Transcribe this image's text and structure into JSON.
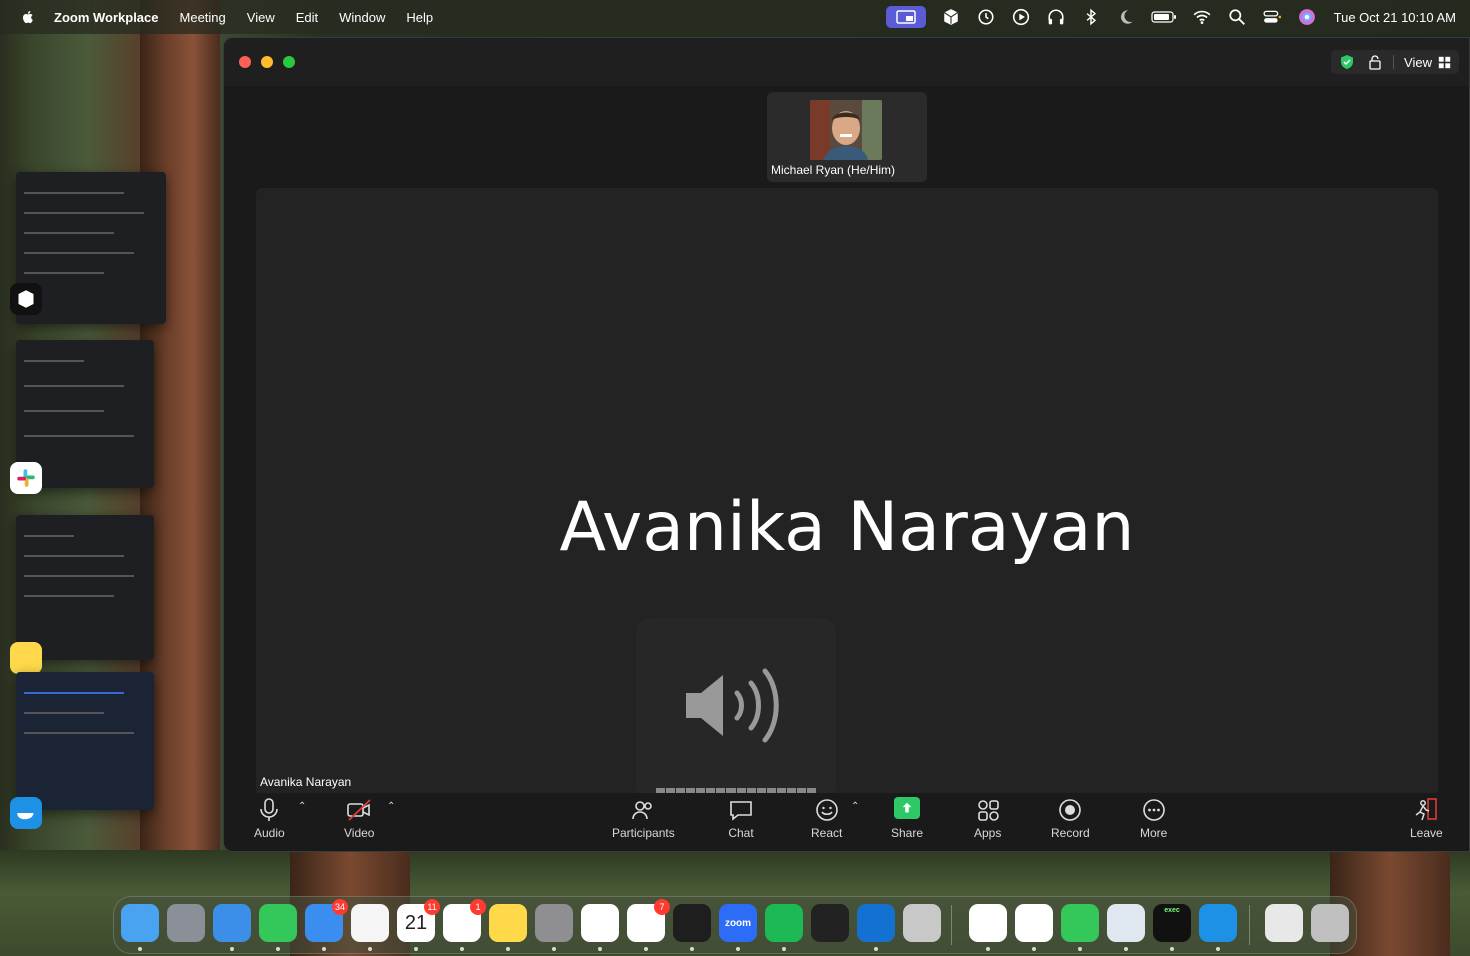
{
  "menubar": {
    "app_name": "Zoom Workplace",
    "menus": [
      "Meeting",
      "View",
      "Edit",
      "Window",
      "Help"
    ],
    "clock": "Tue Oct 21  10:10 AM",
    "status_icons": [
      "screen-share-icon",
      "cube-icon",
      "time-machine-icon",
      "play-icon",
      "headphones-icon",
      "bluetooth-icon",
      "moon-icon",
      "battery-icon",
      "wifi-icon",
      "spotlight-search-icon",
      "control-center-icon",
      "siri-icon"
    ]
  },
  "zoom": {
    "title_bar": {
      "view_label": "View"
    },
    "thumbnail": {
      "name": "Michael Ryan (He/Him)"
    },
    "main": {
      "speaker_name": "Avanika Narayan",
      "speaker_label": "Avanika Narayan"
    },
    "toolbar": {
      "audio": "Audio",
      "video": "Video",
      "participants": "Participants",
      "chat": "Chat",
      "react": "React",
      "share": "Share",
      "apps": "Apps",
      "record": "Record",
      "more": "More",
      "leave": "Leave"
    }
  },
  "dock": {
    "items": [
      {
        "name": "finder",
        "color": "#4aa3f0"
      },
      {
        "name": "launchpad",
        "color": "#8a8f98"
      },
      {
        "name": "safari",
        "color": "#3b8fe8"
      },
      {
        "name": "messages",
        "color": "#34c759"
      },
      {
        "name": "mail",
        "color": "#3a8ef0",
        "badge": "34"
      },
      {
        "name": "photos",
        "color": "#f5f5f5"
      },
      {
        "name": "calendar",
        "color": "#ffffff",
        "badge": "11",
        "text": "21"
      },
      {
        "name": "reminders",
        "color": "#ffffff",
        "badge": "1"
      },
      {
        "name": "notes",
        "color": "#ffd94a"
      },
      {
        "name": "system-settings",
        "color": "#8e8e93"
      },
      {
        "name": "chatgpt",
        "color": "#ffffff"
      },
      {
        "name": "slack",
        "color": "#ffffff",
        "badge": "7"
      },
      {
        "name": "terminal",
        "color": "#1e1e1e"
      },
      {
        "name": "zoom",
        "color": "#2d6cf6",
        "text": "zoom"
      },
      {
        "name": "spotify",
        "color": "#1db954"
      },
      {
        "name": "cube-app",
        "color": "#222222"
      },
      {
        "name": "outlook",
        "color": "#1372d1"
      },
      {
        "name": "simulator",
        "color": "#c8c8c8"
      },
      {
        "name": "chrome",
        "color": "#ffffff"
      },
      {
        "name": "zotero",
        "color": "#ffffff"
      },
      {
        "name": "numbers",
        "color": "#34c759"
      },
      {
        "name": "keychain",
        "color": "#dfe8f0"
      },
      {
        "name": "exec-terminal",
        "color": "#111111",
        "text": "exec"
      },
      {
        "name": "docker",
        "color": "#1d91e6"
      },
      {
        "name": "downloads-stack",
        "color": "#e8e8e8"
      },
      {
        "name": "trash",
        "color": "#c0c0c0"
      }
    ]
  }
}
